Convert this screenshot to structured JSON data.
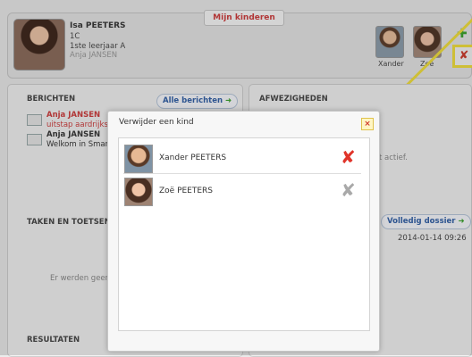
{
  "header": {
    "tab_title": "Mijn kinderen",
    "child": {
      "name": "Isa PEETERS",
      "class": "1C",
      "year": "1ste leerjaar A",
      "teacher": "Anja JANSEN"
    },
    "children": [
      {
        "label": "Xander"
      },
      {
        "label": "Zoë"
      }
    ],
    "add_icon": "plus-icon",
    "delete_icon": "red-x-icon"
  },
  "berichten": {
    "title": "BERICHTEN",
    "all_label": "Alle berichten",
    "messages": [
      {
        "from": "Anja JANSEN",
        "subject": "uitstap aardrijksku"
      },
      {
        "from": "Anja JANSEN",
        "subject": "Welkom in Smarts"
      }
    ]
  },
  "afwezigheden": {
    "title": "AFWEZIGHEDEN",
    "text_fragment": "t actief."
  },
  "taken": {
    "title": "TAKEN EN TOETSEN",
    "empty_fragment": "Er werden geen t"
  },
  "dossier": {
    "button_label": "Volledig dossier",
    "timestamp": "2014-01-14 09:26"
  },
  "resultaten": {
    "title": "RESULTATEN"
  },
  "modal": {
    "title": "Verwijder een kind",
    "close_symbol": "×",
    "rows": [
      {
        "name": "Xander PEETERS",
        "delete_symbol": "✘",
        "delete_color": "#e0342a"
      },
      {
        "name": "Zoë PEETERS",
        "delete_symbol": "✘",
        "delete_color": "#a9a9a9"
      }
    ]
  },
  "colors": {
    "accent_red": "#d03a3a",
    "highlight_yellow": "#f3e13a",
    "link_blue": "#2f5fa8",
    "go_green": "#3aa32b"
  }
}
